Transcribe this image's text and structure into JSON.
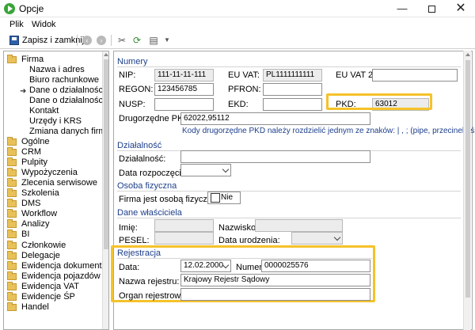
{
  "window": {
    "title": "Opcje",
    "min": "—",
    "close": "✕"
  },
  "menu": {
    "items": [
      "Plik",
      "Widok"
    ]
  },
  "toolbar": {
    "save_label": "Zapisz i zamknij"
  },
  "tree": {
    "root": "Firma",
    "children": [
      "Nazwa i adres",
      "Biuro rachunkowe",
      "Dane o działalności",
      "Dane o działalności",
      "Kontakt",
      "Urzędy i KRS",
      "Zmiana danych firmy"
    ],
    "folders": [
      "Ogólne",
      "CRM",
      "Pulpity",
      "Wypożyczenia",
      "Zlecenia serwisowe",
      "Szkolenia",
      "DMS",
      "Workflow",
      "Analizy",
      "BI",
      "Członkowie",
      "Delegacje",
      "Ewidencja dokumentów",
      "Ewidencja pojazdów",
      "Ewidencja VAT",
      "Ewidencje ŚP",
      "Handel"
    ]
  },
  "numery": {
    "title": "Numery",
    "nip_label": "NIP:",
    "nip_value": "111-11-11-111",
    "euvat_label": "EU VAT:",
    "euvat_value": "PL1111111111",
    "euvat2_label": "EU VAT 2:",
    "euvat2_value": "",
    "regon_label": "REGON:",
    "regon_value": "123456785",
    "pfron_label": "PFRON:",
    "pfron_value": "",
    "nusp_label": "NUSP:",
    "nusp_value": "",
    "ekd_label": "EKD:",
    "ekd_value": "",
    "pkd_label": "PKD:",
    "pkd_value": "63012",
    "drugorzedne_label": "Drugorzędne PKD:",
    "drugorzedne_value": "62022,95112",
    "hint": "Kody drugorzędne PKD należy rozdzielić jednym ze znaków: | , ; (pipe, przecinek, średnik)"
  },
  "dzialalnosc": {
    "title": "Działalność",
    "dzialalnosc_label": "Działalność:",
    "dzialalnosc_value": "",
    "data_rozp_label": "Data rozpoczęcia:",
    "data_rozp_value": ""
  },
  "osoba": {
    "title": "Osoba fizyczna",
    "question": "Firma jest osobą fizyczną:",
    "answer": "Nie"
  },
  "wlasciciel": {
    "title": "Dane właściciela",
    "imie_label": "Imię:",
    "nazwisko_label": "Nazwisko:",
    "pesel_label": "PESEL:",
    "data_ur_label": "Data urodzenia:"
  },
  "rejestracja": {
    "title": "Rejestracja",
    "data_label": "Data:",
    "data_value": "12.02.2000",
    "numer_label": "Numer:",
    "numer_value": "0000025576",
    "nazwa_label": "Nazwa rejestru:",
    "nazwa_value": "Krajowy Rejestr Sądowy",
    "organ_label": "Organ rejestrowy:",
    "organ_value": ""
  },
  "colors": {
    "accent": "#1d3f8b",
    "highlight": "#f5c22a"
  }
}
